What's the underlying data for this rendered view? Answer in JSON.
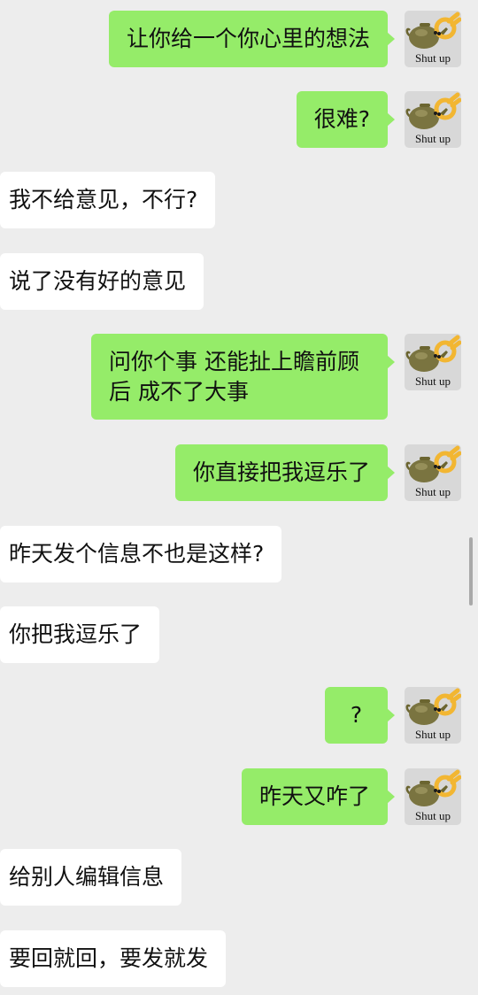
{
  "chat": {
    "avatar_caption": "Shut up",
    "messages": [
      {
        "side": "out",
        "text": "让你给一个你心里的想法"
      },
      {
        "side": "out",
        "text": "很难?"
      },
      {
        "side": "in",
        "text": "我不给意见，不行?"
      },
      {
        "side": "in",
        "text": "说了没有好的意见"
      },
      {
        "side": "out",
        "text": "问你个事 还能扯上瞻前顾后 成不了大事"
      },
      {
        "side": "out",
        "text": "你直接把我逗乐了"
      },
      {
        "side": "in",
        "text": "昨天发个信息不也是这样?"
      },
      {
        "side": "in",
        "text": "你把我逗乐了"
      },
      {
        "side": "out",
        "text": "?"
      },
      {
        "side": "out",
        "text": "昨天又咋了"
      },
      {
        "side": "in",
        "text": "给别人编辑信息"
      },
      {
        "side": "in",
        "text": "要回就回，要发就发"
      }
    ]
  },
  "colors": {
    "background": "#ededed",
    "outgoing_bubble": "#95ec69",
    "incoming_bubble": "#ffffff",
    "text": "#111111"
  },
  "icons": {
    "avatar": "teapot-ok-hand-sticker-icon"
  }
}
